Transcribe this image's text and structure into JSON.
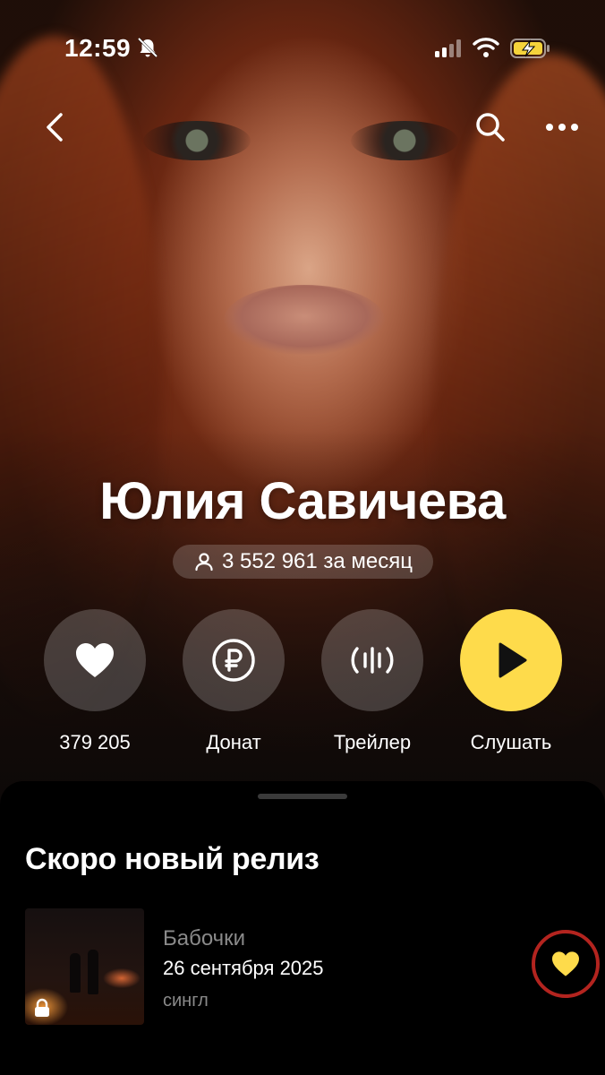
{
  "status_bar": {
    "time": "12:59",
    "icons": [
      "bell-muted-icon",
      "cellular-signal-icon",
      "wifi-icon",
      "battery-charging-icon"
    ]
  },
  "nav": {
    "icons": [
      "back-chevron-icon",
      "search-icon",
      "more-icon"
    ]
  },
  "artist": {
    "name": "Юлия Савичева",
    "listeners": "3 552 961 за месяц",
    "listeners_icon": "person-icon"
  },
  "actions": [
    {
      "label": "379 205",
      "icon": "heart-icon"
    },
    {
      "label": "Донат",
      "icon": "ruble-coin-icon"
    },
    {
      "label": "Трейлер",
      "icon": "waveform-icon"
    },
    {
      "label": "Слушать",
      "icon": "play-icon"
    }
  ],
  "upcoming": {
    "section_title": "Скоро новый релиз",
    "release": {
      "title": "Бабочки",
      "date": "26 сентября 2025",
      "type": "сингл",
      "locked_icon": "lock-icon",
      "like_icon": "heart-icon"
    }
  },
  "colors": {
    "accent_yellow": "#fedb4b",
    "highlight_ring": "#b3241f",
    "secondary_text": "#8a8a8a",
    "background": "#000000"
  }
}
